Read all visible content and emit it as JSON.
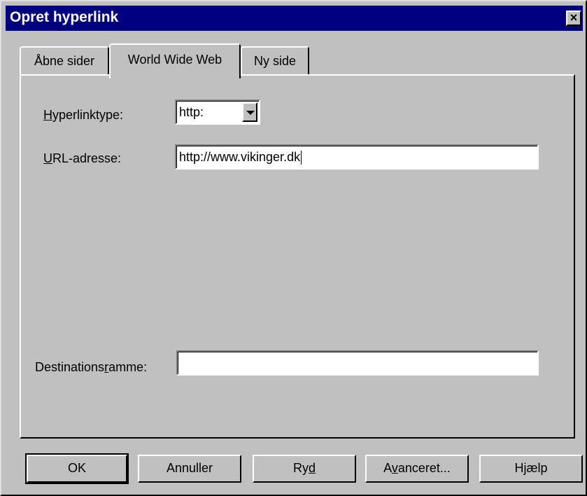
{
  "window": {
    "title": "Opret hyperlink",
    "close_glyph": "×"
  },
  "tabs": [
    {
      "label": "Åbne sider"
    },
    {
      "label": "World Wide Web",
      "active": true
    },
    {
      "label": "Ny side"
    }
  ],
  "form": {
    "hyperlinktype_label_key": "H",
    "hyperlinktype_label_rest": "yperlinktype:",
    "hyperlinktype_value": "http:",
    "url_label_key": "U",
    "url_label_rest": "RL-adresse:",
    "url_value": "http://www.vikinger.dk",
    "dest_label_pre": "Destinations",
    "dest_label_key": "r",
    "dest_label_rest": "amme:",
    "dest_value": ""
  },
  "buttons": {
    "ok": "OK",
    "cancel": "Annuller",
    "clear_pre": "Ry",
    "clear_key": "d",
    "advanced_pre": "A",
    "advanced_key": "v",
    "advanced_rest": "anceret...",
    "help": "Hjælp"
  },
  "icons": {
    "close": "close-icon",
    "dropdown": "chevron-down-icon"
  }
}
